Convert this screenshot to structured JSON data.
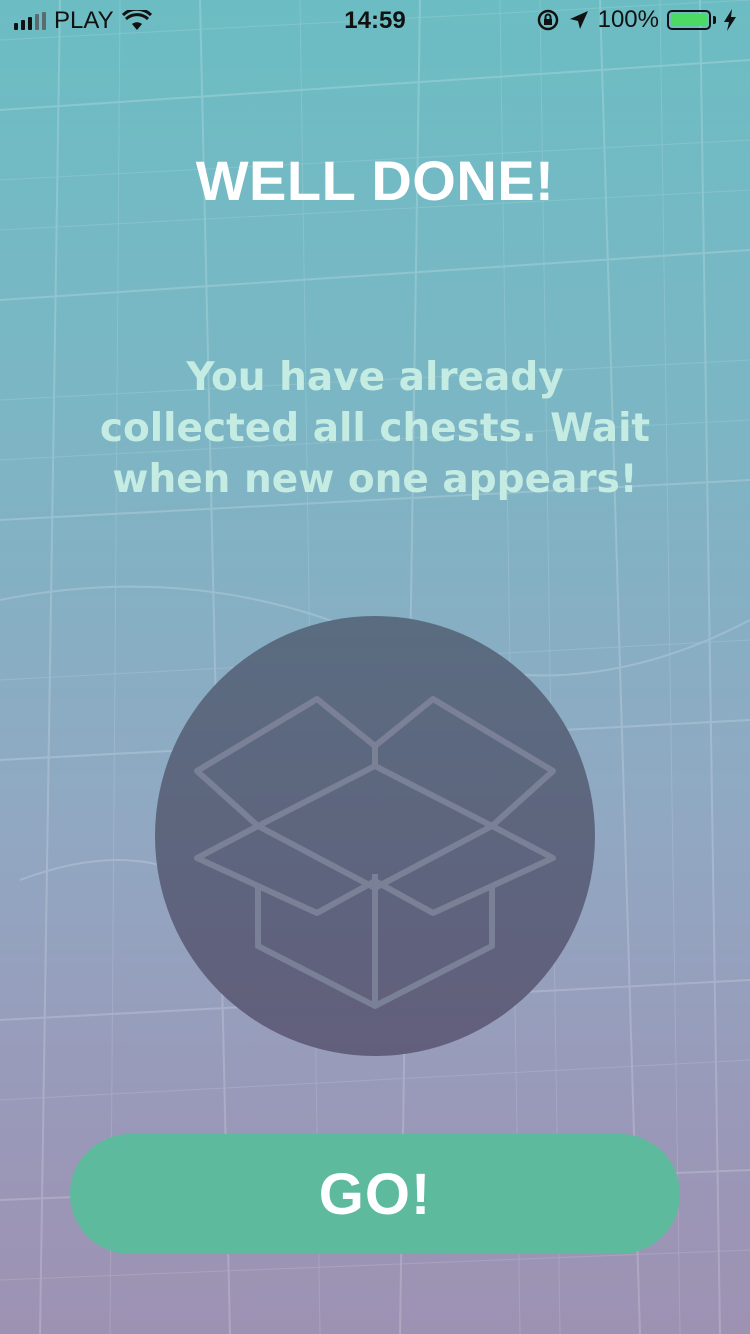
{
  "status_bar": {
    "carrier": "PLAY",
    "time": "14:59",
    "battery_percent": "100%",
    "battery_level": 1.0,
    "battery_color": "#4cd964",
    "icons": [
      "signal-icon",
      "wifi-icon",
      "rotation-lock-icon",
      "location-arrow-icon",
      "battery-icon",
      "charging-icon"
    ]
  },
  "screen": {
    "title": "WELL DONE!",
    "message": "You have already collected all chests. Wait when new one appears!",
    "illustration_icon": "open-box-icon"
  },
  "actions": {
    "go_label": "GO!"
  },
  "colors": {
    "accent_button": "#5dba9c",
    "message_text": "#c5ece2",
    "circle": "#5f6680"
  }
}
